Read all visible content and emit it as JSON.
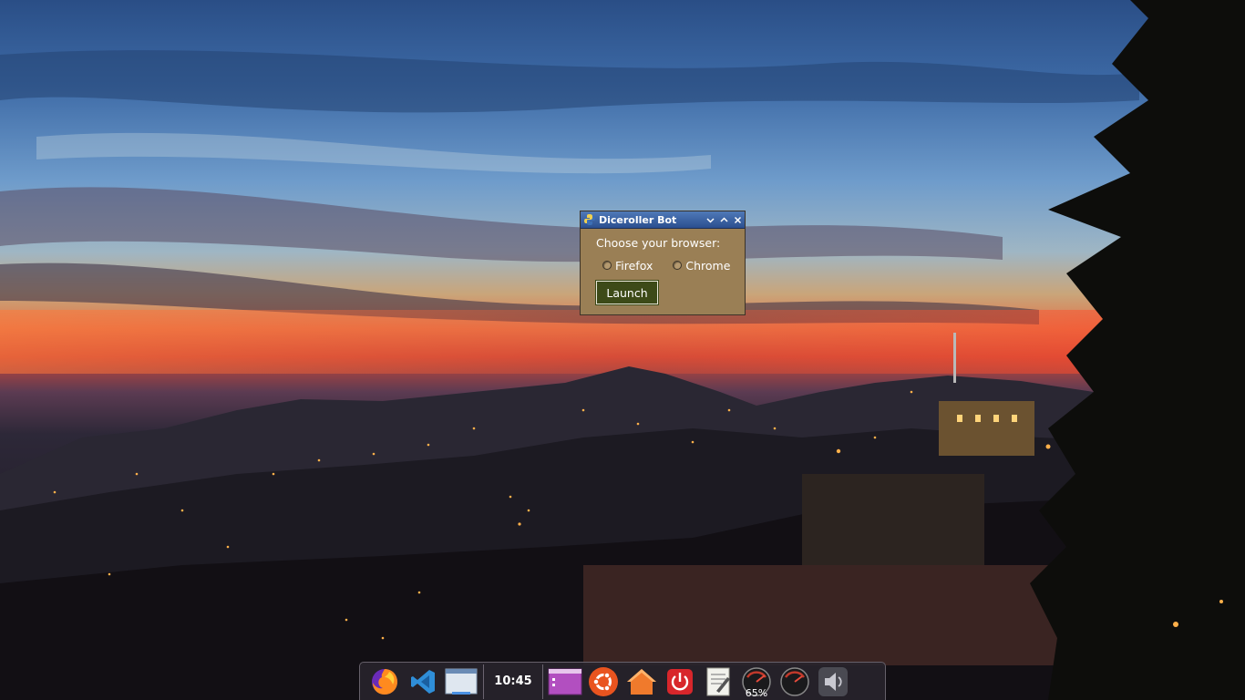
{
  "window": {
    "title": "Diceroller Bot",
    "prompt": "Choose your browser:",
    "options": [
      {
        "label": "Firefox",
        "selected": false
      },
      {
        "label": "Chrome",
        "selected": false
      }
    ],
    "launch_label": "Launch",
    "colors": {
      "titlebar": "#2b4f8f",
      "body": "#9a7f55",
      "button": "#3d4a18"
    }
  },
  "taskbar": {
    "clock": "10:45",
    "gauge_percent": "65%",
    "items": [
      {
        "icon": "firefox-icon"
      },
      {
        "icon": "vscode-icon"
      },
      {
        "icon": "window-icon"
      },
      {
        "icon": "menu-window-icon"
      },
      {
        "icon": "ubuntu-icon"
      },
      {
        "icon": "home-folder-icon"
      },
      {
        "icon": "power-icon"
      },
      {
        "icon": "text-editor-icon"
      },
      {
        "icon": "cpu-gauge-icon"
      },
      {
        "icon": "speedometer-icon"
      },
      {
        "icon": "volume-icon"
      }
    ]
  }
}
